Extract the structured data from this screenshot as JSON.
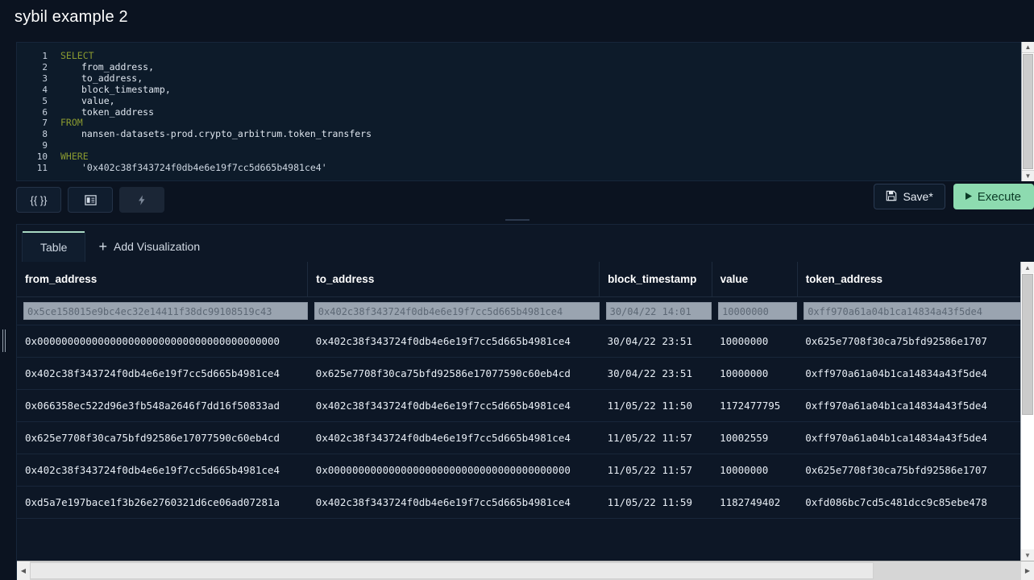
{
  "window": {
    "title": "sybil example 2"
  },
  "editor": {
    "line_numbers": [
      "1",
      "2",
      "3",
      "4",
      "5",
      "6",
      "7",
      "8",
      "9",
      "10",
      "11"
    ],
    "lines": [
      {
        "keyword": "SELECT",
        "text": ""
      },
      {
        "keyword": "",
        "text": "from_address,"
      },
      {
        "keyword": "",
        "text": "to_address,"
      },
      {
        "keyword": "",
        "text": "block_timestamp,"
      },
      {
        "keyword": "",
        "text": "value,"
      },
      {
        "keyword": "",
        "text": "token_address"
      },
      {
        "keyword": "FROM",
        "text": ""
      },
      {
        "keyword": "",
        "text": "nansen-datasets-prod.crypto_arbitrum.token_transfers"
      },
      {
        "keyword": "",
        "text": ""
      },
      {
        "keyword": "WHERE",
        "text": ""
      },
      {
        "keyword": "",
        "text": "'0x402c38f343724f0db4e6e19f7cc5d665b4981ce4'"
      }
    ]
  },
  "toolbar": {
    "format_label": "{{ }}",
    "snippet_icon": "panel-icon",
    "lightning_icon": "lightning-icon",
    "save_label": "Save*",
    "save_icon": "floppy-disk-icon",
    "execute_label": "Execute",
    "execute_icon": "play-icon",
    "execute_color": "#8ddbb0"
  },
  "results": {
    "tabs": [
      {
        "label": "Table",
        "active": true
      }
    ],
    "add_visualization_label": "Add Visualization",
    "columns": [
      "from_address",
      "to_address",
      "block_timestamp",
      "value",
      "token_address"
    ],
    "filters": [
      "0x5ce158015e9bc4ec32e14411f38dc99108519c43",
      "0x402c38f343724f0db4e6e19f7cc5d665b4981ce4",
      "30/04/22 14:01",
      "10000000",
      "0xff970a61a04b1ca14834a43f5de4"
    ],
    "rows": [
      {
        "from_address": "0x0000000000000000000000000000000000000000",
        "to_address": "0x402c38f343724f0db4e6e19f7cc5d665b4981ce4",
        "block_timestamp": "30/04/22 23:51",
        "value": "10000000",
        "token_address": "0x625e7708f30ca75bfd92586e1707"
      },
      {
        "from_address": "0x402c38f343724f0db4e6e19f7cc5d665b4981ce4",
        "to_address": "0x625e7708f30ca75bfd92586e17077590c60eb4cd",
        "block_timestamp": "30/04/22 23:51",
        "value": "10000000",
        "token_address": "0xff970a61a04b1ca14834a43f5de4"
      },
      {
        "from_address": "0x066358ec522d96e3fb548a2646f7dd16f50833ad",
        "to_address": "0x402c38f343724f0db4e6e19f7cc5d665b4981ce4",
        "block_timestamp": "11/05/22 11:50",
        "value": "1172477795",
        "token_address": "0xff970a61a04b1ca14834a43f5de4"
      },
      {
        "from_address": "0x625e7708f30ca75bfd92586e17077590c60eb4cd",
        "to_address": "0x402c38f343724f0db4e6e19f7cc5d665b4981ce4",
        "block_timestamp": "11/05/22 11:57",
        "value": "10002559",
        "token_address": "0xff970a61a04b1ca14834a43f5de4"
      },
      {
        "from_address": "0x402c38f343724f0db4e6e19f7cc5d665b4981ce4",
        "to_address": "0x0000000000000000000000000000000000000000",
        "block_timestamp": "11/05/22 11:57",
        "value": "10000000",
        "token_address": "0x625e7708f30ca75bfd92586e1707"
      },
      {
        "from_address": "0xd5a7e197bace1f3b26e2760321d6ce06ad07281a",
        "to_address": "0x402c38f343724f0db4e6e19f7cc5d665b4981ce4",
        "block_timestamp": "11/05/22 11:59",
        "value": "1182749402",
        "token_address": "0xfd086bc7cd5c481dcc9c85ebe478"
      }
    ]
  },
  "scrollbars": {
    "up_arrow": "▲",
    "down_arrow": "▼",
    "left_arrow": "◀",
    "right_arrow": "▶"
  }
}
